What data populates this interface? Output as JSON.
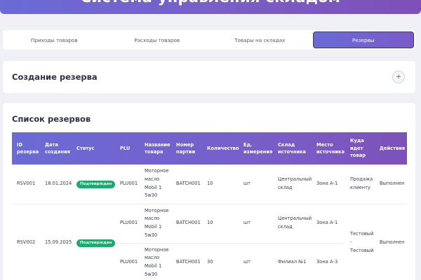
{
  "header": {
    "title": "Система управления складом"
  },
  "tabs": [
    {
      "label": "Приходы товаров",
      "active": false
    },
    {
      "label": "Расходы товаров",
      "active": false
    },
    {
      "label": "Товары на складах",
      "active": false
    },
    {
      "label": "Резервы",
      "active": true
    }
  ],
  "create": {
    "title": "Создание резерва",
    "toggle": "+"
  },
  "list": {
    "title": "Список резервов",
    "columns": [
      "ID резерва",
      "Дата создания",
      "Статус",
      "PLU",
      "Название товара",
      "Номер партии",
      "Количество",
      "Ед. измерения",
      "Склад источника",
      "Место источника",
      "Куда идет товар",
      "Действия"
    ],
    "rows": [
      {
        "id": "RSV001",
        "date": "18.01.2024",
        "status": "Подтвержден",
        "plu": "PLU001",
        "name": "Моторное масло Mobil 1 5w30",
        "batch": "BATCH001",
        "qty": "10",
        "unit": "шт",
        "warehouse": "Центральный склад",
        "location": "Зона А-1",
        "dest": "Продажа клиенту",
        "action": "Выполнен"
      },
      {
        "id": "RSV002",
        "date": "15.09.2025",
        "status": "Подтвержден",
        "plu": "PLU001",
        "name": "Моторное масло Mobil 1 5w30",
        "batch": "BATCH001",
        "qty": "10",
        "unit": "шт",
        "warehouse": "Центральный склад",
        "location": "Зона А-1",
        "dest": "Тестовый - Тестовый",
        "action": "Выполнен"
      },
      {
        "plu": "PLU001",
        "name": "Моторное масло Mobil 1 5w30",
        "batch": "BATCH001",
        "qty": "30",
        "unit": "шт",
        "warehouse": "Филиал №1",
        "location": "Зона А-3"
      }
    ]
  }
}
